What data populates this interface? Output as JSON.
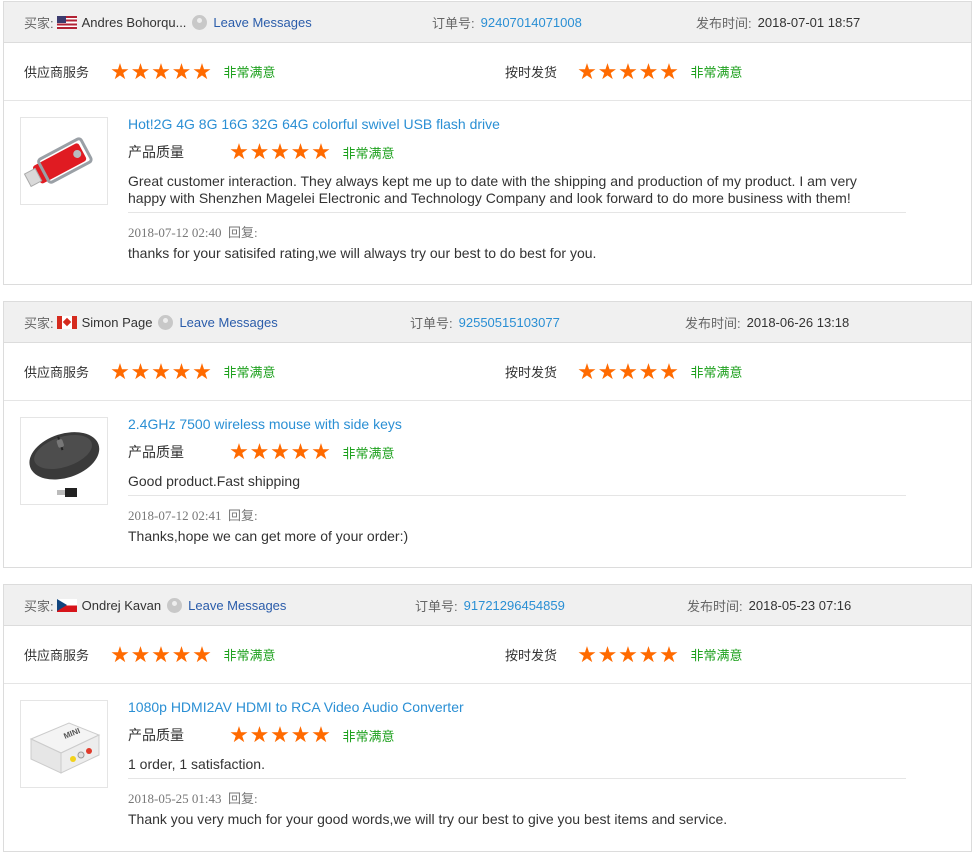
{
  "labels": {
    "buyer": "买家:",
    "leave_messages": "Leave Messages",
    "order_no": "订单号:",
    "publish_time": "发布时间:",
    "supplier_service": "供应商服务",
    "on_time_delivery": "按时发货",
    "product_quality": "产品质量",
    "very_satisfied": "非常满意",
    "reply": "回复:"
  },
  "star_color": "#ff6a00",
  "satisfied_color": "#1ca01c",
  "link_color": "#2a8fd4",
  "reviews": [
    {
      "buyer_name": "Andres Bohorqu...",
      "flag": "us-flag-icon",
      "order_number": "92407014071008",
      "publish_time": "2018-07-01 18:57",
      "supplier_service_stars": 5,
      "on_time_delivery_stars": 5,
      "product_title": "Hot!2G 4G 8G 16G 32G 64G colorful swivel USB flash drive",
      "product_quality_stars": 5,
      "comment": "Great customer interaction. They always kept me up to date with the shipping and production of my product. I am very happy with Shenzhen Magelei Electronic and Technology Company and look forward to do more business with them!",
      "reply_date": "2018-07-12 02:40",
      "reply_text": "thanks for your satisifed rating,we will always try our best to do best for you."
    },
    {
      "buyer_name": "Simon Page",
      "flag": "canada-flag-icon",
      "order_number": "92550515103077",
      "publish_time": "2018-06-26 13:18",
      "supplier_service_stars": 5,
      "on_time_delivery_stars": 5,
      "product_title": "2.4GHz 7500 wireless mouse with side keys",
      "product_quality_stars": 5,
      "comment": "Good product.Fast shipping",
      "reply_date": "2018-07-12 02:41",
      "reply_text": "Thanks,hope we can get more of your order:)"
    },
    {
      "buyer_name": "Ondrej Kavan",
      "flag": "czech-flag-icon",
      "order_number": "91721296454859",
      "publish_time": "2018-05-23 07:16",
      "supplier_service_stars": 5,
      "on_time_delivery_stars": 5,
      "product_title": "1080p HDMI2AV HDMI to RCA Video Audio Converter",
      "product_quality_stars": 5,
      "comment": "1 order, 1 satisfaction.",
      "reply_date": "2018-05-25 01:43",
      "reply_text": "Thank you very much for your good words,we will try our best to give you best items and service.",
      "product_image_text": "MINI"
    }
  ]
}
